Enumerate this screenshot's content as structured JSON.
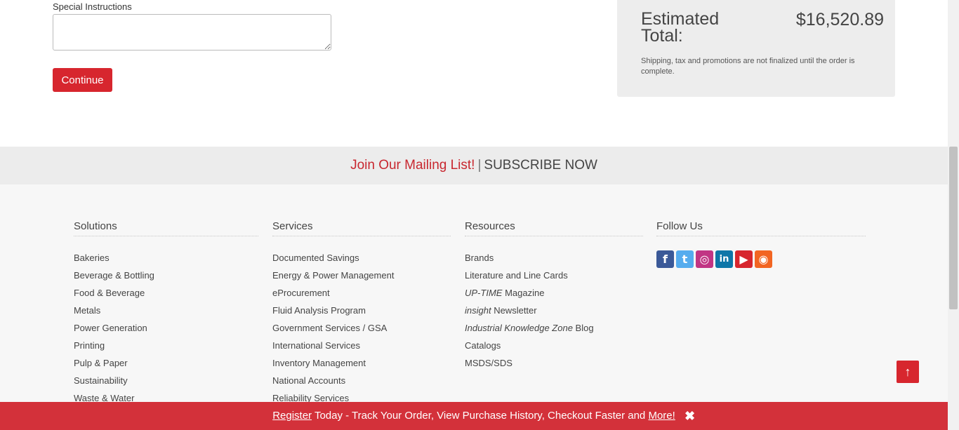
{
  "form": {
    "special_instructions_label": "Special Instructions",
    "special_instructions_value": "",
    "continue_label": "Continue"
  },
  "summary": {
    "estimated_total_label": "Estimated Total:",
    "estimated_total_value": "$16,520.89",
    "note": "Shipping, tax and promotions are not finalized until the order is complete."
  },
  "mailing": {
    "join_text": "Join Our Mailing List!",
    "separator": "|",
    "subscribe_text": "SUBSCRIBE NOW"
  },
  "footer": {
    "solutions": {
      "heading": "Solutions",
      "items": [
        "Bakeries",
        "Beverage & Bottling",
        "Food & Beverage",
        "Metals",
        "Power Generation",
        "Printing",
        "Pulp & Paper",
        "Sustainability",
        "Waste & Water"
      ]
    },
    "services": {
      "heading": "Services",
      "items": [
        "Documented Savings",
        "Energy & Power Management",
        "eProcurement",
        "Fluid Analysis Program",
        "Government Services / GSA",
        "International Services",
        "Inventory Management",
        "National Accounts",
        "Reliability Services"
      ]
    },
    "resources": {
      "heading": "Resources",
      "items": [
        {
          "em": "",
          "text": "Brands"
        },
        {
          "em": "",
          "text": "Literature and Line Cards"
        },
        {
          "em": "UP-TIME",
          "text": " Magazine"
        },
        {
          "em": "insight",
          "text": " Newsletter"
        },
        {
          "em": "Industrial Knowledge Zone",
          "text": " Blog"
        },
        {
          "em": "",
          "text": "Catalogs"
        },
        {
          "em": "",
          "text": "MSDS/SDS"
        }
      ]
    },
    "follow": {
      "heading": "Follow Us",
      "icons": [
        {
          "name": "facebook-icon",
          "glyph": "f",
          "color": "#3b5998"
        },
        {
          "name": "twitter-icon",
          "glyph": "t",
          "color": "#55acee"
        },
        {
          "name": "instagram-icon",
          "glyph": "◎",
          "color": "#c13584"
        },
        {
          "name": "linkedin-icon",
          "glyph": "in",
          "color": "#0e76a8"
        },
        {
          "name": "youtube-icon",
          "glyph": "▶",
          "color": "#d7262e"
        },
        {
          "name": "rss-icon",
          "glyph": "◉",
          "color": "#f26522"
        }
      ]
    }
  },
  "scroll_top": {
    "icon": "arrow-up-icon",
    "glyph": "↑"
  },
  "banner": {
    "register": "Register",
    "middle": " Today - Track Your Order, View Purchase History, Checkout Faster and ",
    "more": "More!",
    "close_glyph": "✖"
  }
}
